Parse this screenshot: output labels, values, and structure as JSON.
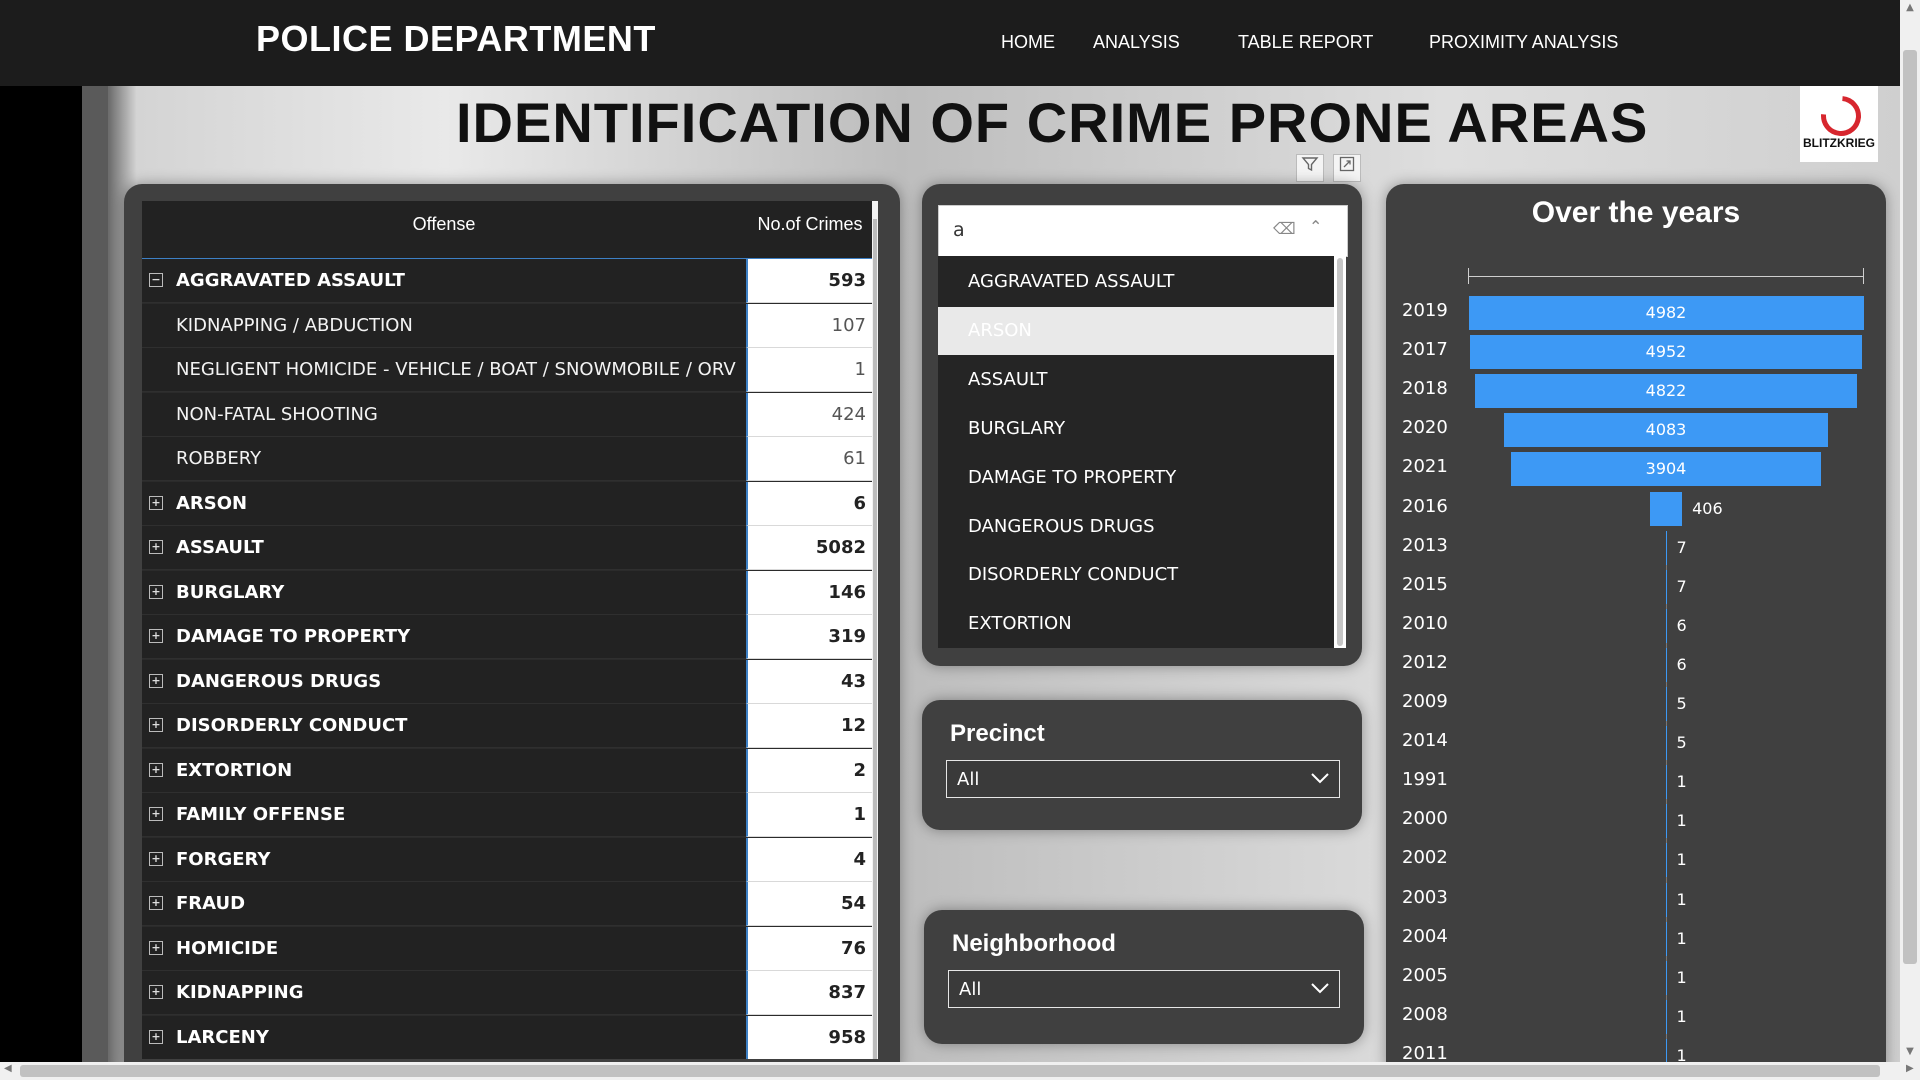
{
  "topbar": {
    "brand": "POLICE DEPARTMENT",
    "nav": [
      {
        "label": "HOME"
      },
      {
        "label": "ANALYSIS"
      },
      {
        "label": "TABLE REPORT"
      },
      {
        "label": "PROXIMITY ANALYSIS"
      }
    ]
  },
  "report": {
    "title": "IDENTIFICATION OF CRIME PRONE AREAS",
    "logo_text": "BLITZKRIEG"
  },
  "table": {
    "col_offense": "Offense",
    "col_count": "No.of Crimes",
    "rows": [
      {
        "label": "AGGRAVATED ASSAULT",
        "value": "593",
        "level": 0,
        "expander": "−"
      },
      {
        "label": "KIDNAPPING / ABDUCTION",
        "value": "107",
        "level": 1,
        "expander": ""
      },
      {
        "label": "NEGLIGENT HOMICIDE - VEHICLE / BOAT / SNOWMOBILE / ORV",
        "value": "1",
        "level": 1,
        "expander": ""
      },
      {
        "label": "NON-FATAL SHOOTING",
        "value": "424",
        "level": 1,
        "expander": ""
      },
      {
        "label": "ROBBERY",
        "value": "61",
        "level": 1,
        "expander": ""
      },
      {
        "label": "ARSON",
        "value": "6",
        "level": 0,
        "expander": "+"
      },
      {
        "label": "ASSAULT",
        "value": "5082",
        "level": 0,
        "expander": "+"
      },
      {
        "label": "BURGLARY",
        "value": "146",
        "level": 0,
        "expander": "+"
      },
      {
        "label": "DAMAGE TO PROPERTY",
        "value": "319",
        "level": 0,
        "expander": "+"
      },
      {
        "label": "DANGEROUS DRUGS",
        "value": "43",
        "level": 0,
        "expander": "+"
      },
      {
        "label": "DISORDERLY CONDUCT",
        "value": "12",
        "level": 0,
        "expander": "+"
      },
      {
        "label": "EXTORTION",
        "value": "2",
        "level": 0,
        "expander": "+"
      },
      {
        "label": "FAMILY OFFENSE",
        "value": "1",
        "level": 0,
        "expander": "+"
      },
      {
        "label": "FORGERY",
        "value": "4",
        "level": 0,
        "expander": "+"
      },
      {
        "label": "FRAUD",
        "value": "54",
        "level": 0,
        "expander": "+"
      },
      {
        "label": "HOMICIDE",
        "value": "76",
        "level": 0,
        "expander": "+"
      },
      {
        "label": "KIDNAPPING",
        "value": "837",
        "level": 0,
        "expander": "+"
      },
      {
        "label": "LARCENY",
        "value": "958",
        "level": 0,
        "expander": "+"
      }
    ]
  },
  "offense_slicer": {
    "search_value": "a",
    "items": [
      {
        "label": "AGGRAVATED ASSAULT",
        "selected": false
      },
      {
        "label": "ARSON",
        "selected": true
      },
      {
        "label": "ASSAULT",
        "selected": false
      },
      {
        "label": "BURGLARY",
        "selected": false
      },
      {
        "label": "DAMAGE TO PROPERTY",
        "selected": false
      },
      {
        "label": "DANGEROUS DRUGS",
        "selected": false
      },
      {
        "label": "DISORDERLY CONDUCT",
        "selected": false
      },
      {
        "label": "EXTORTION",
        "selected": false
      }
    ]
  },
  "precinct": {
    "title": "Precinct",
    "value": "All"
  },
  "neighborhood": {
    "title": "Neighborhood",
    "value": "All"
  },
  "chart_data": {
    "type": "bar",
    "title": "Over the years",
    "orientation": "horizontal-centered",
    "categories": [
      "2019",
      "2017",
      "2018",
      "2020",
      "2021",
      "2016",
      "2013",
      "2015",
      "2010",
      "2012",
      "2009",
      "2014",
      "1991",
      "2000",
      "2002",
      "2003",
      "2004",
      "2005",
      "2008",
      "2011"
    ],
    "values": [
      4982,
      4952,
      4822,
      4083,
      3904,
      406,
      7,
      7,
      6,
      6,
      5,
      5,
      1,
      1,
      1,
      1,
      1,
      1,
      1,
      1
    ],
    "color": "#3d99f5"
  }
}
